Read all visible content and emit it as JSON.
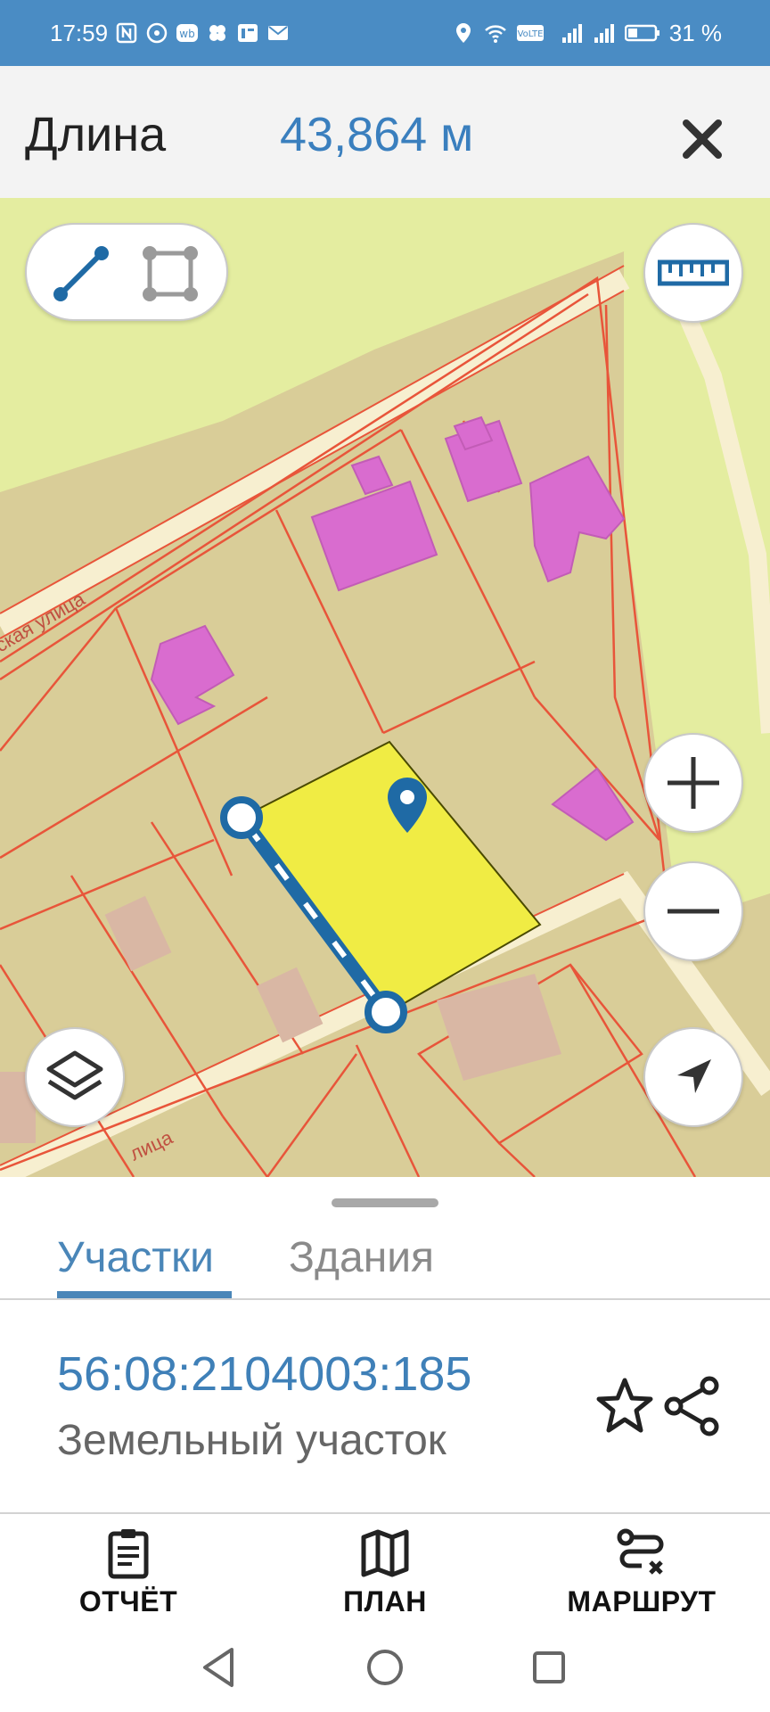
{
  "status_bar": {
    "time": "17:59",
    "battery": "31 %",
    "left_icons": [
      "nfc-icon",
      "chat-icon",
      "wb-icon",
      "flower-icon",
      "news-icon",
      "mail-icon"
    ],
    "right_icons": [
      "location-icon",
      "wifi-icon",
      "volte-icon",
      "signal-icon",
      "signal-icon",
      "battery-icon"
    ]
  },
  "header": {
    "label": "Длина",
    "value": "43,864 м"
  },
  "map": {
    "street_labels": [
      "ская улица",
      "лица"
    ],
    "parcel_color": "#f0ec44",
    "building_color": "#d96ccf",
    "boundary_color": "#e8553a",
    "measure_color": "#1f6aa5"
  },
  "sheet": {
    "tabs": [
      {
        "label": "Участки",
        "active": true
      },
      {
        "label": "Здания",
        "active": false
      }
    ],
    "parcel_id": "56:08:2104003:185",
    "parcel_type": "Земельный участок"
  },
  "bottom_nav": [
    {
      "label": "ОТЧЁТ",
      "icon": "clipboard-icon"
    },
    {
      "label": "ПЛАН",
      "icon": "map-icon"
    },
    {
      "label": "МАРШРУТ",
      "icon": "route-icon"
    }
  ],
  "colors": {
    "status_bar": "#4a8cc4",
    "accent": "#3a7fbe"
  }
}
